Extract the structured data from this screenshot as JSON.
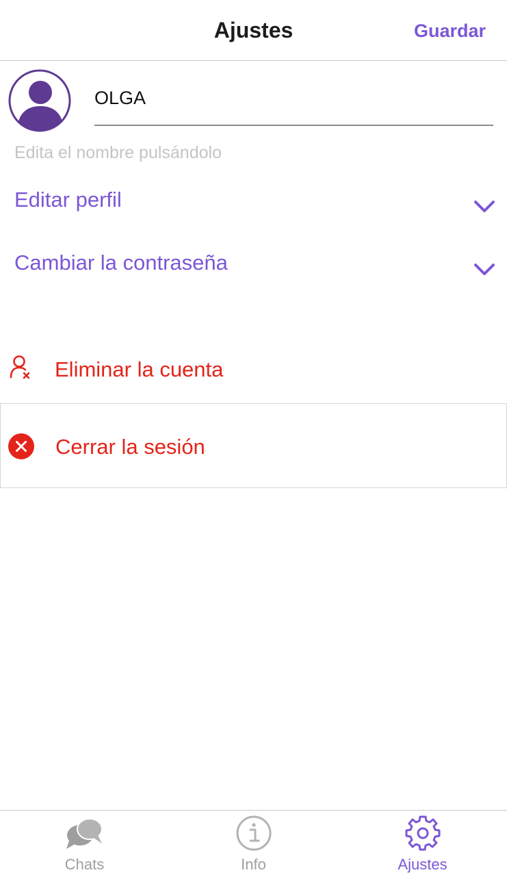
{
  "header": {
    "title": "Ajustes",
    "save_label": "Guardar"
  },
  "profile": {
    "avatar_icon": "user-avatar-icon",
    "name_value": "OLGA",
    "hint": "Edita el nombre pulsándolo"
  },
  "sections": [
    {
      "label": "Editar perfil",
      "icon": "chevron-down-icon"
    },
    {
      "label": "Cambiar la contraseña",
      "icon": "chevron-down-icon"
    }
  ],
  "actions": {
    "delete_account": {
      "label": "Eliminar la cuenta",
      "icon": "user-remove-icon"
    },
    "logout": {
      "label": "Cerrar la sesión",
      "icon": "close-circle-icon"
    }
  },
  "tabbar": {
    "tabs": [
      {
        "label": "Chats",
        "icon": "chat-bubbles-icon",
        "active": false
      },
      {
        "label": "Info",
        "icon": "info-icon",
        "active": false
      },
      {
        "label": "Ajustes",
        "icon": "gear-icon",
        "active": true
      }
    ]
  },
  "colors": {
    "accent": "#7b57d6",
    "danger": "#e3241b",
    "inactive": "#9e9e9e",
    "hint": "#c4c4c4"
  }
}
